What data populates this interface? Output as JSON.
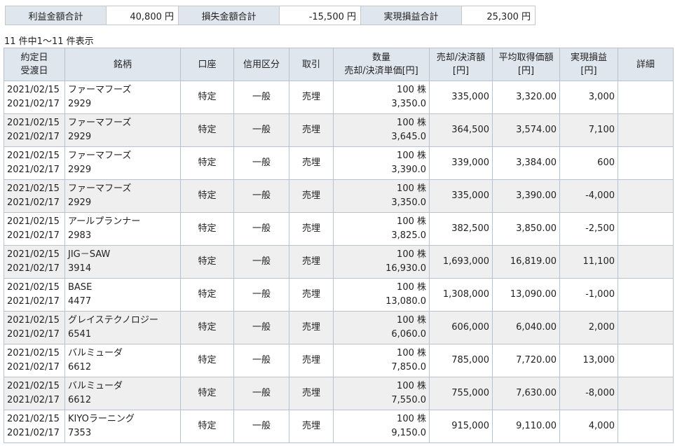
{
  "summary": {
    "profit_label": "利益金額合計",
    "profit_value": "40,800 円",
    "loss_label": "損失金額合計",
    "loss_value": "-15,500 円",
    "realized_label": "実現損益合計",
    "realized_value": "25,300 円"
  },
  "count_text": "11 件中1～11 件表示",
  "headers": {
    "date_l1": "約定日",
    "date_l2": "受渡日",
    "stock": "銘柄",
    "account": "口座",
    "credit": "信用区分",
    "trade": "取引",
    "qty_l1": "数量",
    "qty_l2": "売却/決済単価[円]",
    "amount_l1": "売却/決済額",
    "amount_l2": "[円]",
    "avg_l1": "平均取得価額",
    "avg_l2": "[円]",
    "pl_l1": "実現損益",
    "pl_l2": "[円]",
    "detail": "詳細"
  },
  "rows": [
    {
      "trade_date": "2021/02/15",
      "settle_date": "2021/02/17",
      "name": "ファーマフーズ",
      "code": "2929",
      "account": "特定",
      "credit": "一般",
      "trade": "売埋",
      "qty": "100 株",
      "price": "3,350.0",
      "amount": "335,000",
      "avg": "3,320.00",
      "pl": "3,000"
    },
    {
      "trade_date": "2021/02/15",
      "settle_date": "2021/02/17",
      "name": "ファーマフーズ",
      "code": "2929",
      "account": "特定",
      "credit": "一般",
      "trade": "売埋",
      "qty": "100 株",
      "price": "3,645.0",
      "amount": "364,500",
      "avg": "3,574.00",
      "pl": "7,100"
    },
    {
      "trade_date": "2021/02/15",
      "settle_date": "2021/02/17",
      "name": "ファーマフーズ",
      "code": "2929",
      "account": "特定",
      "credit": "一般",
      "trade": "売埋",
      "qty": "100 株",
      "price": "3,390.0",
      "amount": "339,000",
      "avg": "3,384.00",
      "pl": "600"
    },
    {
      "trade_date": "2021/02/15",
      "settle_date": "2021/02/17",
      "name": "ファーマフーズ",
      "code": "2929",
      "account": "特定",
      "credit": "一般",
      "trade": "売埋",
      "qty": "100 株",
      "price": "3,350.0",
      "amount": "335,000",
      "avg": "3,390.00",
      "pl": "-4,000"
    },
    {
      "trade_date": "2021/02/15",
      "settle_date": "2021/02/17",
      "name": "アールプランナー",
      "code": "2983",
      "account": "特定",
      "credit": "一般",
      "trade": "売埋",
      "qty": "100 株",
      "price": "3,825.0",
      "amount": "382,500",
      "avg": "3,850.00",
      "pl": "-2,500"
    },
    {
      "trade_date": "2021/02/15",
      "settle_date": "2021/02/17",
      "name": "JIG－SAW",
      "code": "3914",
      "account": "特定",
      "credit": "一般",
      "trade": "売埋",
      "qty": "100 株",
      "price": "16,930.0",
      "amount": "1,693,000",
      "avg": "16,819.00",
      "pl": "11,100"
    },
    {
      "trade_date": "2021/02/15",
      "settle_date": "2021/02/17",
      "name": "BASE",
      "code": "4477",
      "account": "特定",
      "credit": "一般",
      "trade": "売埋",
      "qty": "100 株",
      "price": "13,080.0",
      "amount": "1,308,000",
      "avg": "13,090.00",
      "pl": "-1,000"
    },
    {
      "trade_date": "2021/02/15",
      "settle_date": "2021/02/17",
      "name": "グレイステクノロジー",
      "code": "6541",
      "account": "特定",
      "credit": "一般",
      "trade": "売埋",
      "qty": "100 株",
      "price": "6,060.0",
      "amount": "606,000",
      "avg": "6,040.00",
      "pl": "2,000"
    },
    {
      "trade_date": "2021/02/15",
      "settle_date": "2021/02/17",
      "name": "バルミューダ",
      "code": "6612",
      "account": "特定",
      "credit": "一般",
      "trade": "売埋",
      "qty": "100 株",
      "price": "7,850.0",
      "amount": "785,000",
      "avg": "7,720.00",
      "pl": "13,000"
    },
    {
      "trade_date": "2021/02/15",
      "settle_date": "2021/02/17",
      "name": "バルミューダ",
      "code": "6612",
      "account": "特定",
      "credit": "一般",
      "trade": "売埋",
      "qty": "100 株",
      "price": "7,550.0",
      "amount": "755,000",
      "avg": "7,630.00",
      "pl": "-8,000"
    },
    {
      "trade_date": "2021/02/15",
      "settle_date": "2021/02/17",
      "name": "KIYOラーニング",
      "code": "7353",
      "account": "特定",
      "credit": "一般",
      "trade": "売埋",
      "qty": "100 株",
      "price": "9,150.0",
      "amount": "915,000",
      "avg": "9,110.00",
      "pl": "4,000"
    }
  ]
}
